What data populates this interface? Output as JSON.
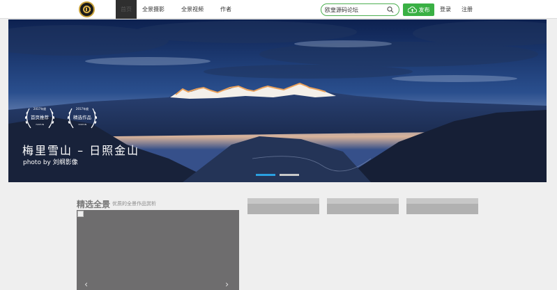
{
  "header": {
    "nav": [
      {
        "label": "首页"
      },
      {
        "label": "全景摄影"
      },
      {
        "label": "全景视频"
      },
      {
        "label": "作者"
      }
    ],
    "search": {
      "value": "欧皇源码论坛"
    },
    "publish_label": "发布",
    "login_label": "登录",
    "register_label": "注册",
    "colors": {
      "accent": "#3ab044",
      "active_nav": "#2f2f2f"
    }
  },
  "banner": {
    "title": "梅里雪山 – 日照金山",
    "credit": "photo by 刘纲影像",
    "badges": [
      {
        "year": "2017年度",
        "text": "首页推荐",
        "sub": "720YUN"
      },
      {
        "year": "2017年度",
        "text": "精选作品",
        "sub": "720YUN"
      }
    ],
    "slides": {
      "count": 2,
      "active": 1
    }
  },
  "featured": {
    "title": "精选全景",
    "subtitle": "优质的全景作品赏析",
    "prev_arrow": "‹",
    "next_arrow": "›"
  }
}
